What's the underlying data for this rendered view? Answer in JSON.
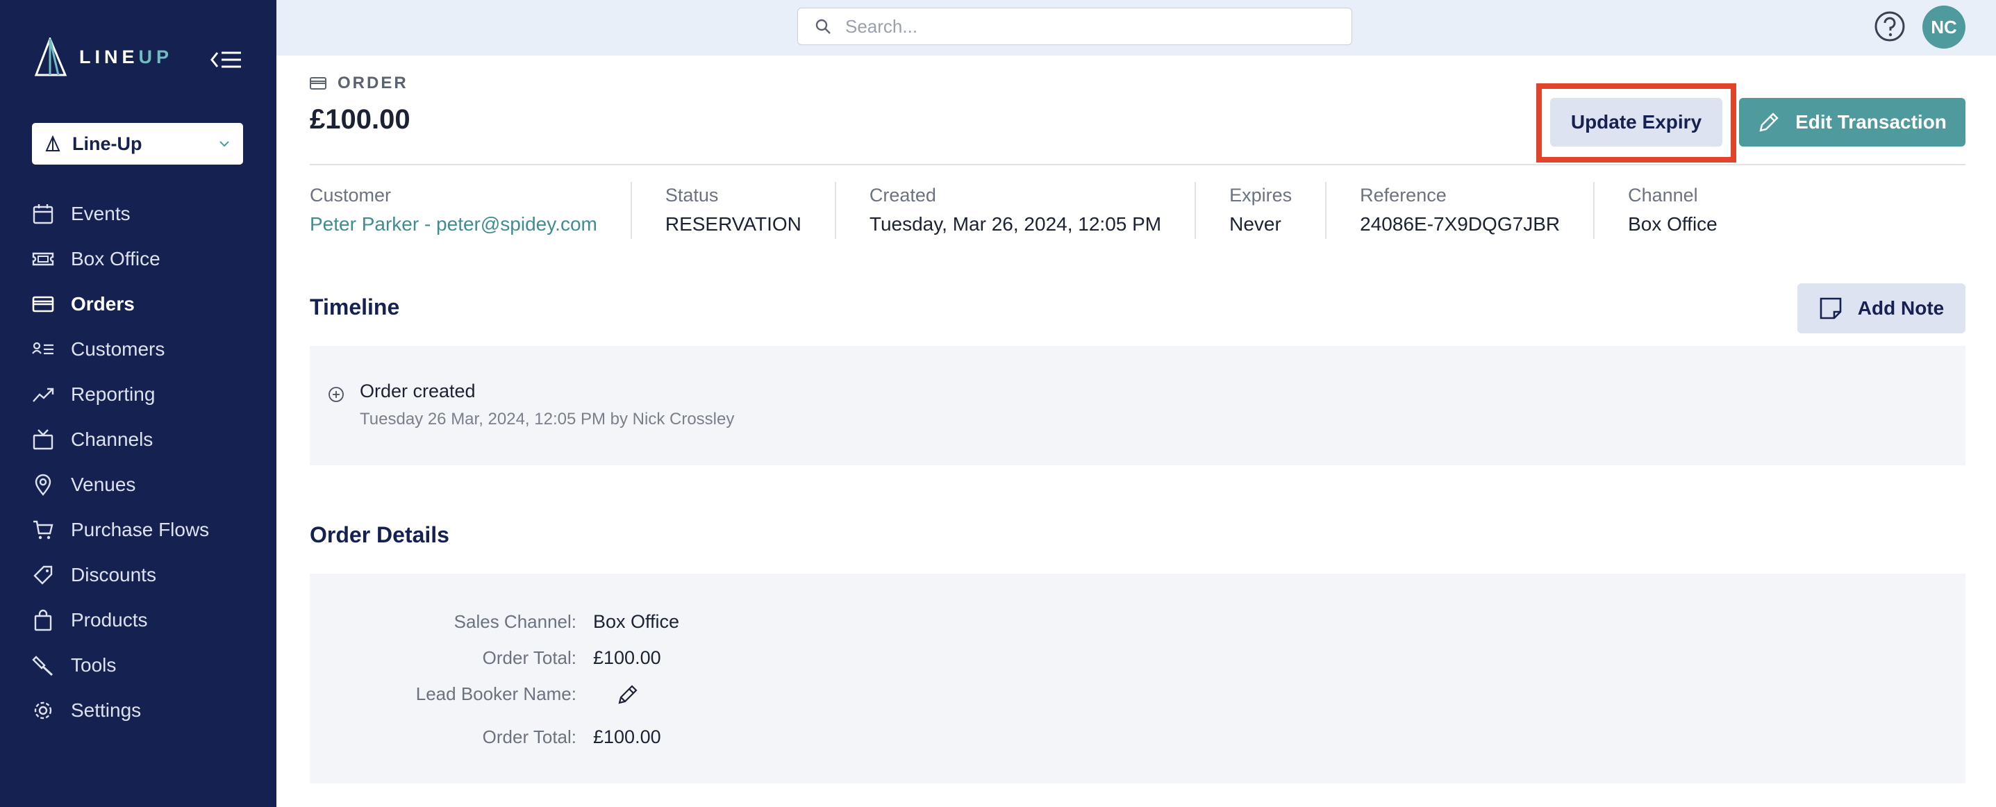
{
  "brand": {
    "logo_main": "LINE",
    "logo_accent": "UP"
  },
  "org": {
    "selected": "Line-Up"
  },
  "nav": [
    {
      "label": "Events",
      "icon": "calendar-icon",
      "active": false
    },
    {
      "label": "Box Office",
      "icon": "ticket-icon",
      "active": false
    },
    {
      "label": "Orders",
      "icon": "credit-card-icon",
      "active": true
    },
    {
      "label": "Customers",
      "icon": "customers-list-icon",
      "active": false
    },
    {
      "label": "Reporting",
      "icon": "trend-chart-icon",
      "active": false
    },
    {
      "label": "Channels",
      "icon": "tv-icon",
      "active": false
    },
    {
      "label": "Venues",
      "icon": "map-pin-icon",
      "active": false
    },
    {
      "label": "Purchase Flows",
      "icon": "cart-icon",
      "active": false
    },
    {
      "label": "Discounts",
      "icon": "tag-icon",
      "active": false
    },
    {
      "label": "Products",
      "icon": "shopping-bag-icon",
      "active": false
    },
    {
      "label": "Tools",
      "icon": "hammer-icon",
      "active": false
    },
    {
      "label": "Settings",
      "icon": "gear-icon",
      "active": false
    }
  ],
  "topbar": {
    "search_placeholder": "Search...",
    "avatar_initials": "NC"
  },
  "order": {
    "eyebrow": "ORDER",
    "amount": "£100.00",
    "update_expiry_label": "Update Expiry",
    "edit_transaction_label": "Edit Transaction",
    "meta": [
      {
        "label": "Customer",
        "value": "Peter Parker - peter@spidey.com",
        "link": true
      },
      {
        "label": "Status",
        "value": "RESERVATION",
        "link": false
      },
      {
        "label": "Created",
        "value": "Tuesday, Mar 26, 2024, 12:05 PM",
        "link": false
      },
      {
        "label": "Expires",
        "value": "Never",
        "link": false
      },
      {
        "label": "Reference",
        "value": "24086E-7X9DQG7JBR",
        "link": false
      },
      {
        "label": "Channel",
        "value": "Box Office",
        "link": false
      }
    ]
  },
  "timeline": {
    "title": "Timeline",
    "add_note_label": "Add Note",
    "events": [
      {
        "title": "Order created",
        "subtitle": "Tuesday 26 Mar, 2024, 12:05 PM by Nick Crossley"
      }
    ]
  },
  "details": {
    "title": "Order Details",
    "rows": [
      {
        "label": "Sales Channel:",
        "value": "Box Office"
      },
      {
        "label": "Order Total:",
        "value": "£100.00"
      },
      {
        "label": "Lead Booker Name:",
        "value": ""
      },
      {
        "label": "Order Total:",
        "value": "£100.00"
      }
    ]
  },
  "colors": {
    "sidebar": "#152150",
    "accent": "#4e9a9d",
    "highlight": "#e2432b"
  }
}
